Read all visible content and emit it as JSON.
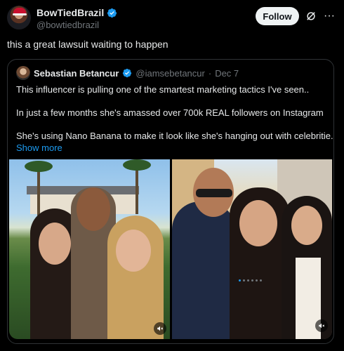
{
  "author": {
    "display_name": "BowTiedBrazil",
    "handle": "@bowtiedbrazil",
    "verified": true
  },
  "actions": {
    "follow_label": "Follow",
    "grok_icon": "grok-icon",
    "more_icon": "more-icon"
  },
  "tweet": {
    "text": "this a great lawsuit waiting to happen"
  },
  "quoted_tweet": {
    "display_name": "Sebastian Betancur",
    "handle": "@iamsebetancur",
    "separator": "·",
    "date": "Dec 7",
    "verified": true,
    "lines": [
      "This influencer is pulling one of the smartest marketing tactics I've seen..",
      "In just a few months she's amassed over 700k REAL followers on Instagram",
      "She's using Nano Banana to make it look like she's hanging out with celebritie..."
    ],
    "show_more": "Show more"
  },
  "media": {
    "count": 2,
    "carousel_dots": 6,
    "active_dot": 0
  },
  "colors": {
    "background": "#000000",
    "text": "#e7e9ea",
    "muted": "#71767b",
    "accent": "#1d9bf0",
    "border": "#2f3336"
  }
}
